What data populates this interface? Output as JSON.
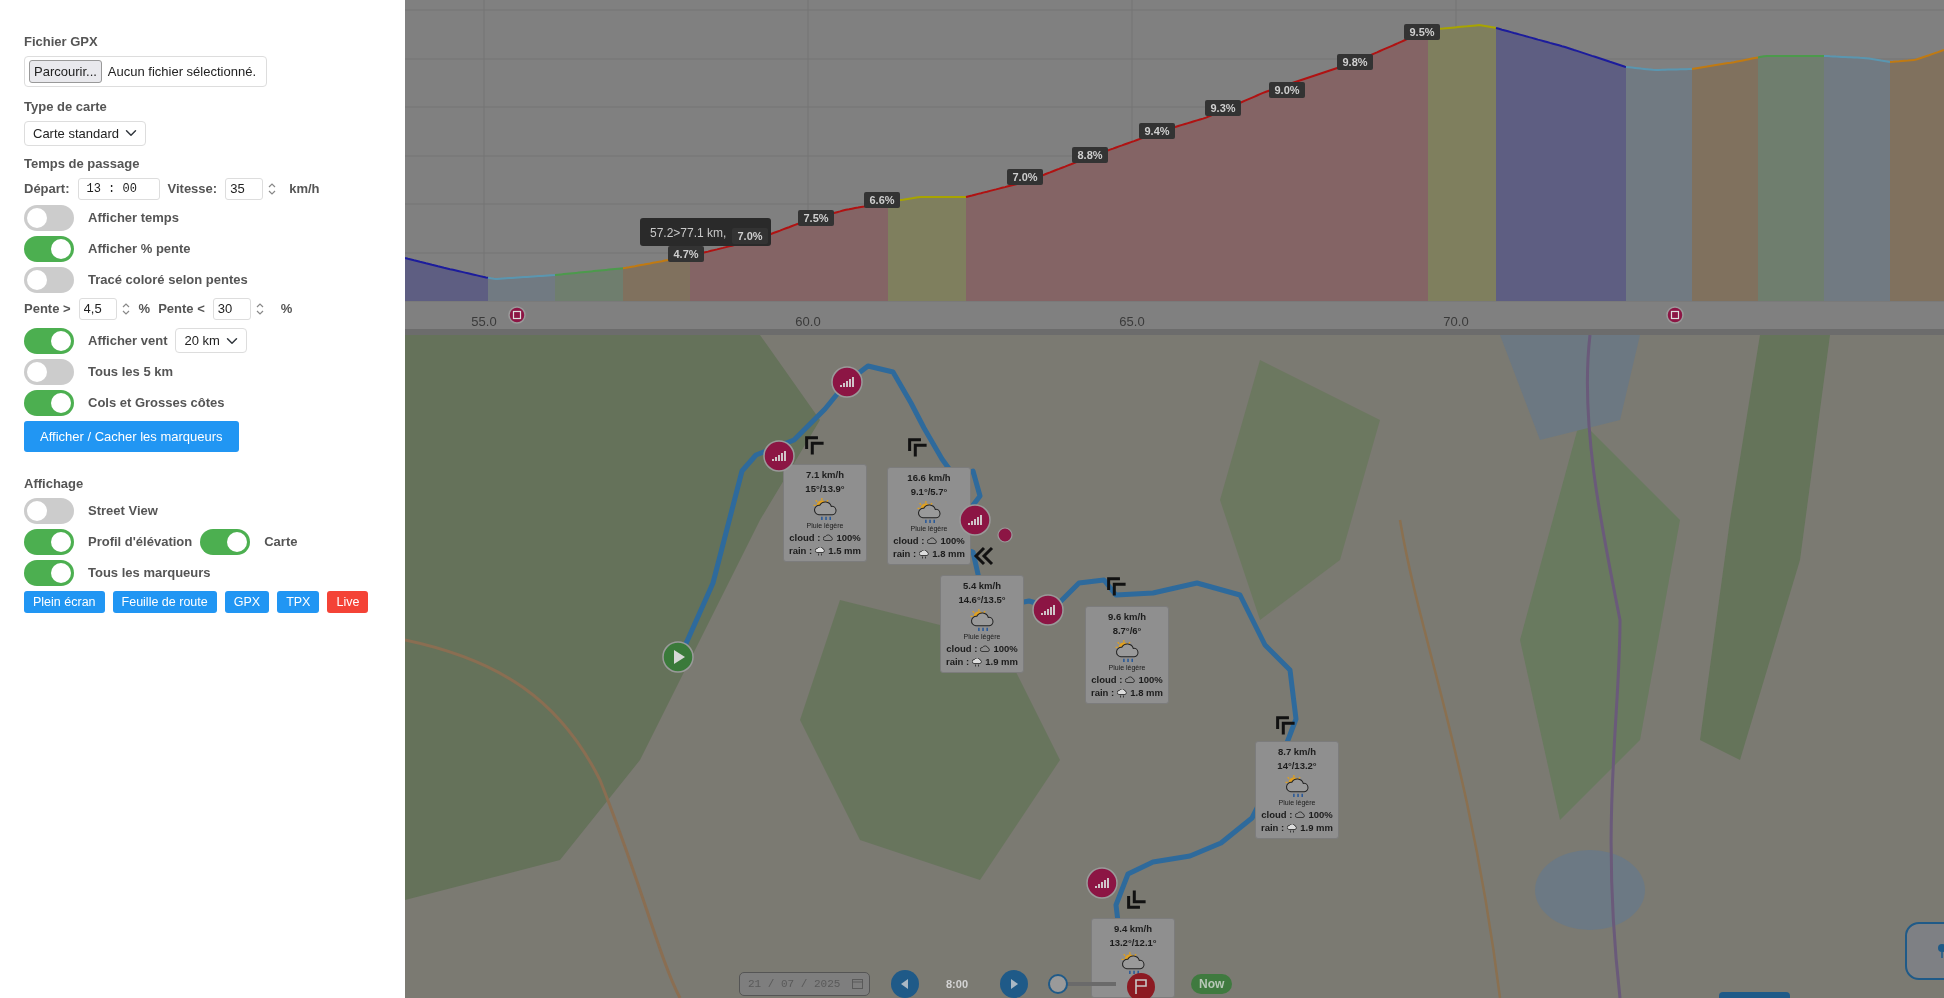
{
  "sidebar": {
    "rows": [
      {
        "kind": "heading",
        "text": "Fichier GPX"
      },
      {
        "kind": "file",
        "button": "Parcourir...",
        "status": "Aucun fichier sélectionné."
      },
      {
        "kind": "heading",
        "text": "Type de carte"
      },
      {
        "kind": "select",
        "value": "Carte standard"
      },
      {
        "kind": "heading",
        "text": "Temps de passage"
      },
      {
        "kind": "timing",
        "start_label": "Départ:",
        "start_value": "13 : 00",
        "speed_label": "Vitesse:",
        "speed_value": "35",
        "unit": "km/h"
      },
      {
        "kind": "toggle",
        "label": "Afficher temps",
        "on": false
      },
      {
        "kind": "toggle",
        "label": "Afficher % pente",
        "on": true
      },
      {
        "kind": "toggle",
        "label": "Tracé coloré selon pentes",
        "on": false
      },
      {
        "kind": "slopes",
        "min_label": "Pente >",
        "min_value": "4,5",
        "min_unit": "%",
        "max_label": "Pente <",
        "max_value": "30",
        "max_unit": "%"
      },
      {
        "kind": "toggle",
        "label": "Afficher vent",
        "on": true,
        "select": "20 km"
      },
      {
        "kind": "toggle",
        "label": "Tous les 5 km",
        "on": false
      },
      {
        "kind": "toggle",
        "label": "Cols et Grosses côtes",
        "on": true
      },
      {
        "kind": "button",
        "text": "Afficher / Cacher les marqueurs"
      },
      {
        "kind": "heading",
        "text": "Affichage"
      },
      {
        "kind": "toggle",
        "label": "Street View",
        "on": false
      },
      {
        "kind": "toggle_pair",
        "items": [
          {
            "label": "Profil d'élévation",
            "on": true
          },
          {
            "label": "Carte",
            "on": true
          }
        ]
      },
      {
        "kind": "toggle",
        "label": "Tous les marqueurs",
        "on": true
      },
      {
        "kind": "buttons",
        "items": [
          {
            "text": "Plein écran",
            "color": "#2196f3"
          },
          {
            "text": "Feuille de route",
            "color": "#2196f3"
          },
          {
            "text": "GPX",
            "color": "#2196f3"
          },
          {
            "text": "TPX",
            "color": "#2196f3"
          },
          {
            "text": "Live",
            "color": "#f44336"
          }
        ]
      }
    ]
  },
  "elevation_profile": {
    "x_ticks": [
      "55.0",
      "60.0",
      "65.0",
      "70.0"
    ],
    "slope_labels": [
      "4.7%",
      "7.0%",
      "7.5%",
      "6.6%",
      "7.0%",
      "8.8%",
      "9.4%",
      "9.3%",
      "9.0%",
      "9.8%",
      "9.5%"
    ],
    "tooltip": "57.2>77.1 km,"
  },
  "map": {
    "weather_cards": [
      {
        "speed": "7.1 km/h",
        "temps": "15°/13.9°",
        "description": "Pluie légère",
        "cloud_label": "cloud :",
        "cloud": "100%",
        "rain_label": "rain :",
        "rain": "1.5 mm"
      },
      {
        "speed": "16.6 km/h",
        "temps": "9.1°/5.7°",
        "description": "Pluie légère",
        "cloud_label": "cloud :",
        "cloud": "100%",
        "rain_label": "rain :",
        "rain": "1.8 mm"
      },
      {
        "speed": "5.4 km/h",
        "temps": "14.6°/13.5°",
        "description": "Pluie légère",
        "cloud_label": "cloud :",
        "cloud": "100%",
        "rain_label": "rain :",
        "rain": "1.9 mm"
      },
      {
        "speed": "9.6 km/h",
        "temps": "8.7°/6°",
        "description": "Pluie légère",
        "cloud_label": "cloud :",
        "cloud": "100%",
        "rain_label": "rain :",
        "rain": "1.8 mm"
      },
      {
        "speed": "8.7 km/h",
        "temps": "14°/13.2°",
        "description": "Pluie légère",
        "cloud_label": "cloud :",
        "cloud": "100%",
        "rain_label": "rain :",
        "rain": "1.9 mm"
      },
      {
        "speed": "9.4 km/h",
        "temps": "13.2°/12.1°"
      }
    ],
    "controls": {
      "date": "21 / 07 / 2025",
      "time": "8:00",
      "level": 0,
      "now_button": "Now"
    }
  }
}
